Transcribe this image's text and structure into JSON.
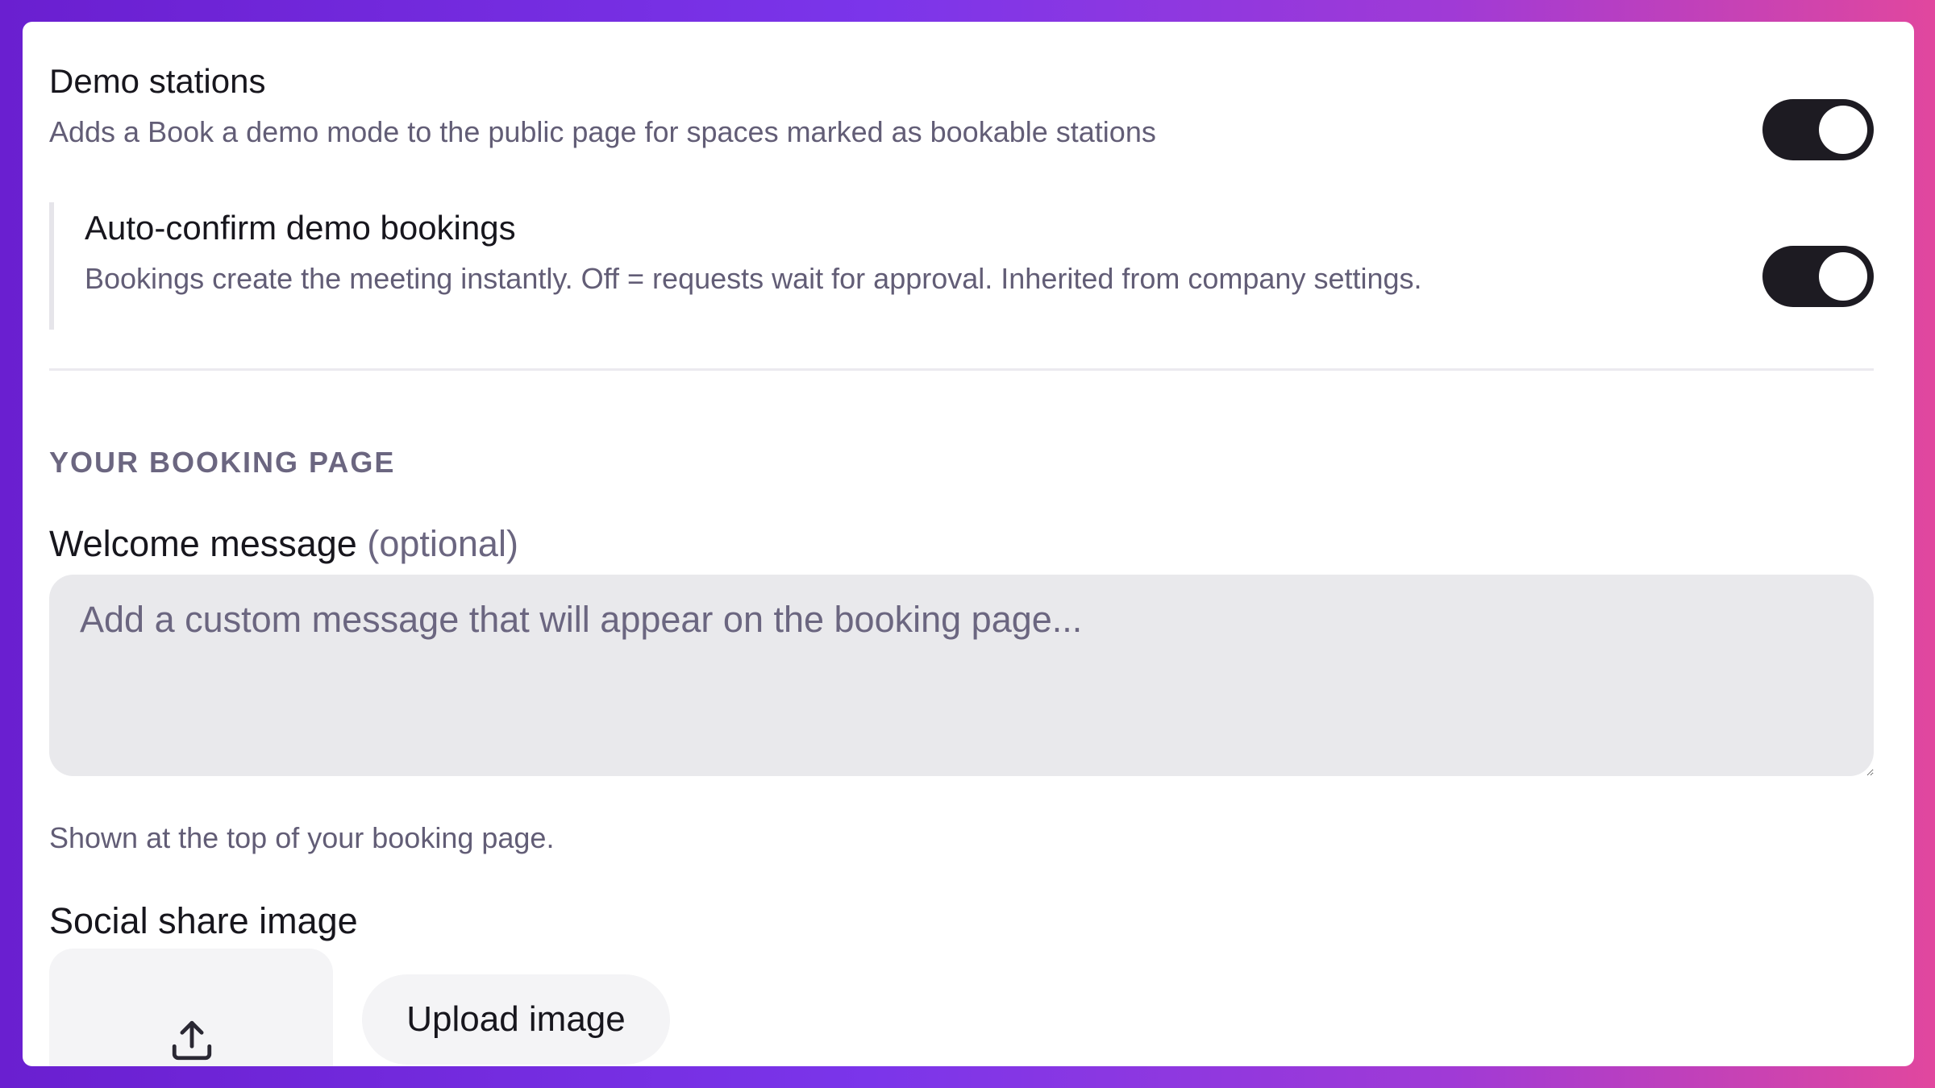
{
  "settings": {
    "demo_stations": {
      "title": "Demo stations",
      "description": "Adds a Book a demo mode to the public page for spaces marked as bookable stations",
      "enabled": true
    },
    "auto_confirm": {
      "title": "Auto-confirm demo bookings",
      "description": "Bookings create the meeting instantly. Off = requests wait for approval. Inherited from company settings.",
      "enabled": true
    }
  },
  "booking_page": {
    "section_title": "YOUR BOOKING PAGE",
    "welcome": {
      "label": "Welcome message",
      "optional": "(optional)",
      "placeholder": "Add a custom message that will appear on the booking page...",
      "value": "",
      "hint": "Shown at the top of your booking page."
    },
    "social_share": {
      "label": "Social share image",
      "upload_label": "Upload image",
      "icon": "upload-icon"
    }
  },
  "colors": {
    "toggle_on": "#1d1b22",
    "text_primary": "#17161d",
    "text_secondary": "#625d76",
    "input_bg": "#e9e9ec"
  }
}
